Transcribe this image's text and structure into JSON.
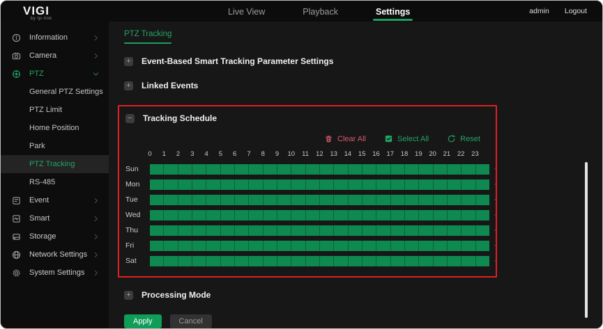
{
  "logo": {
    "brand": "VIGI",
    "sub": "by tp-link"
  },
  "topnav": {
    "items": [
      {
        "label": "Live View",
        "active": false
      },
      {
        "label": "Playback",
        "active": false
      },
      {
        "label": "Settings",
        "active": true
      }
    ],
    "user": "admin",
    "logout": "Logout"
  },
  "sidebar": {
    "items": [
      {
        "icon": "info-icon",
        "label": "Information",
        "chevron": "right"
      },
      {
        "icon": "camera-icon",
        "label": "Camera",
        "chevron": "right"
      },
      {
        "icon": "ptz-icon",
        "label": "PTZ",
        "chevron": "down",
        "active": true,
        "children": [
          "General PTZ Settings",
          "PTZ Limit",
          "Home Position",
          "Park",
          "PTZ Tracking",
          "RS-485"
        ],
        "selected_child": "PTZ Tracking"
      },
      {
        "icon": "event-icon",
        "label": "Event",
        "chevron": "right"
      },
      {
        "icon": "smart-icon",
        "label": "Smart",
        "chevron": "right"
      },
      {
        "icon": "storage-icon",
        "label": "Storage",
        "chevron": "right"
      },
      {
        "icon": "network-icon",
        "label": "Network Settings",
        "chevron": "right"
      },
      {
        "icon": "system-icon",
        "label": "System Settings",
        "chevron": "right"
      }
    ]
  },
  "content": {
    "tab": "PTZ Tracking",
    "sections": [
      {
        "title": "Event-Based Smart Tracking Parameter Settings",
        "state": "collapsed"
      },
      {
        "title": "Linked Events",
        "state": "collapsed"
      }
    ],
    "schedule": {
      "title": "Tracking Schedule",
      "state": "expanded",
      "highlight_color": "#e02020",
      "actions": [
        {
          "icon": "trash-icon",
          "label": "Clear All",
          "color": "#d85a6e"
        },
        {
          "icon": "select-all-icon",
          "label": "Select All",
          "color": "#23a566"
        },
        {
          "icon": "reset-icon",
          "label": "Reset",
          "color": "#23a566"
        }
      ],
      "hours": [
        "0",
        "1",
        "2",
        "3",
        "4",
        "5",
        "6",
        "7",
        "8",
        "9",
        "10",
        "11",
        "12",
        "13",
        "14",
        "15",
        "16",
        "17",
        "18",
        "19",
        "20",
        "21",
        "22",
        "23"
      ],
      "days": [
        {
          "label": "Sun",
          "selected_ranges": [
            [
              0,
              24
            ]
          ]
        },
        {
          "label": "Mon",
          "selected_ranges": [
            [
              0,
              24
            ]
          ]
        },
        {
          "label": "Tue",
          "selected_ranges": [
            [
              0,
              24
            ]
          ]
        },
        {
          "label": "Wed",
          "selected_ranges": [
            [
              0,
              24
            ]
          ]
        },
        {
          "label": "Thu",
          "selected_ranges": [
            [
              0,
              24
            ]
          ]
        },
        {
          "label": "Fri",
          "selected_ranges": [
            [
              0,
              24
            ]
          ]
        },
        {
          "label": "Sat",
          "selected_ranges": [
            [
              0,
              24
            ]
          ]
        }
      ],
      "bar_color": "#0e8a50"
    },
    "processing": {
      "title": "Processing Mode",
      "state": "collapsed"
    },
    "apply_label": "Apply",
    "cancel_label": "Cancel"
  },
  "colors": {
    "accent_green": "#23a566",
    "underline_green": "#1ba05f",
    "clear_red": "#d85a6e"
  }
}
